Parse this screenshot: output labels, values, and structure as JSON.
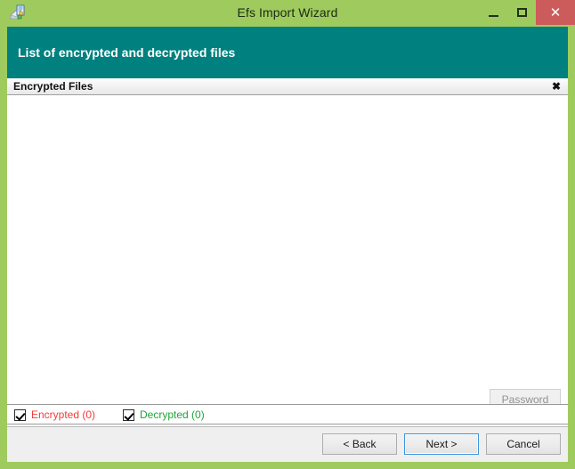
{
  "window": {
    "title": "Efs Import Wizard",
    "icon": "certificate-import-icon",
    "chrome_color": "#9fcb5e",
    "controls": {
      "minimize": "–",
      "maximize": "□",
      "close": "✕",
      "close_bg": "#cc5b5b"
    }
  },
  "banner": {
    "text": "List of encrypted and decrypted files",
    "background": "#00807e",
    "text_color": "#ffffff"
  },
  "group": {
    "title": "Encrypted Files",
    "close_label": "✖"
  },
  "file_list": {
    "items": [],
    "empty": ""
  },
  "actions": {
    "password_label": "Password",
    "password_enabled": false
  },
  "legend": {
    "encrypted": {
      "label": "Encrypted (0)",
      "checked": true,
      "color": "#f23b3b"
    },
    "decrypted": {
      "label": "Decrypted (0)",
      "checked": true,
      "color": "#1ca63b"
    }
  },
  "footer": {
    "back_label": "< Back",
    "next_label": "Next >",
    "cancel_label": "Cancel",
    "focused_button": "Next >"
  }
}
